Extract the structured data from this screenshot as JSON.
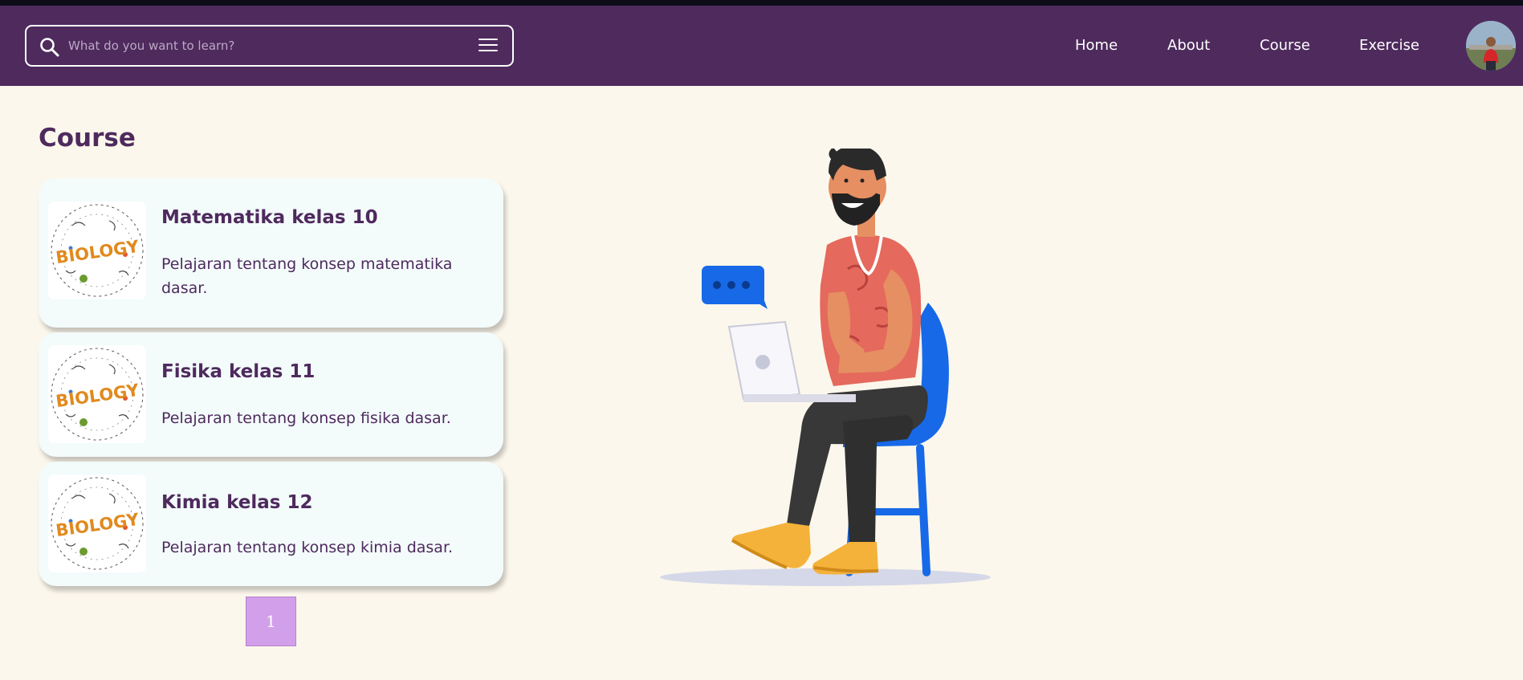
{
  "search": {
    "placeholder": "What do you want to learn?"
  },
  "nav": {
    "home": "Home",
    "about": "About",
    "course": "Course",
    "exercise": "Exercise"
  },
  "page": {
    "title": "Course"
  },
  "courses": [
    {
      "title": "Matematika kelas 10",
      "description": "Pelajaran tentang konsep matematika dasar.",
      "thumb_text": "BIOLOGY"
    },
    {
      "title": "Fisika kelas 11",
      "description": "Pelajaran tentang konsep fisika dasar.",
      "thumb_text": "BIOLOGY"
    },
    {
      "title": "Kimia kelas 12",
      "description": "Pelajaran tentang konsep kimia dasar.",
      "thumb_text": "BIOLOGY"
    }
  ],
  "pagination": {
    "current": "1"
  },
  "colors": {
    "navbar": "#4e2a5d",
    "background": "#fcf7ec",
    "card": "#f3fbfb",
    "accent": "#d2a0ea",
    "text": "#4e2a5d"
  },
  "icons": {
    "search": "search-icon",
    "menu": "hamburger-menu-icon"
  }
}
